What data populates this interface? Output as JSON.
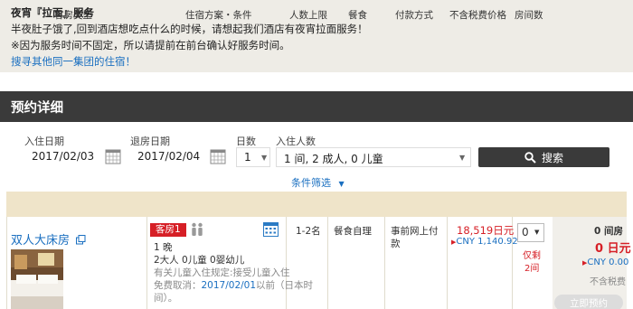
{
  "notice": {
    "title": "夜宵『拉面』服务",
    "line1": "半夜肚子饿了,回到酒店想吃点什么的时候，请想起我们酒店有夜宵拉面服务！",
    "line2": "※因为服务时间不固定，所以请提前在前台确认好服务时间。",
    "link": "搜寻其他同一集团的住宿！"
  },
  "section_title": "预约详细",
  "search": {
    "checkin_label": "入住日期",
    "checkin_value": "2017/02/03",
    "checkout_label": "退房日期",
    "checkout_value": "2017/02/04",
    "nights_label": "日数",
    "nights_value": "1",
    "guests_label": "入住人数",
    "guests_value": "1 间, 2 成人, 0 儿童",
    "search_button": "搜索",
    "filter_link": "条件筛选"
  },
  "table": {
    "headers": [
      "客房类型",
      "住宿方案・条件",
      "人数上限",
      "餐食",
      "付款方式",
      "不含税费价格",
      "房间数"
    ]
  },
  "room": {
    "name": "双人大床房",
    "badge": "客房1",
    "nights": "1 晚",
    "occupancy": "2大人 0儿童 0婴幼儿",
    "policy_line1": "有关儿童入住规定:接受儿童入住",
    "cancel_prefix": "免费取消：",
    "cancel_date": "2017/02/01",
    "cancel_suffix": "以前（日本时",
    "cancel_suffix2": "间）。",
    "capacity": "1-2名",
    "meal": "餐食自理",
    "payment_line1": "事前网上付",
    "payment_line2": "款",
    "price_jpy": "18,519日元",
    "price_cny": "CNY 1,140.92",
    "qty_value": "0",
    "remaining_line1": "仅剩",
    "remaining_line2": "2间"
  },
  "summary": {
    "rooms": "0 间房",
    "total_jpy": "0 日元",
    "total_cny": "CNY 0.00",
    "tax_note": "不含税费",
    "reserve_button": "立即预约"
  }
}
